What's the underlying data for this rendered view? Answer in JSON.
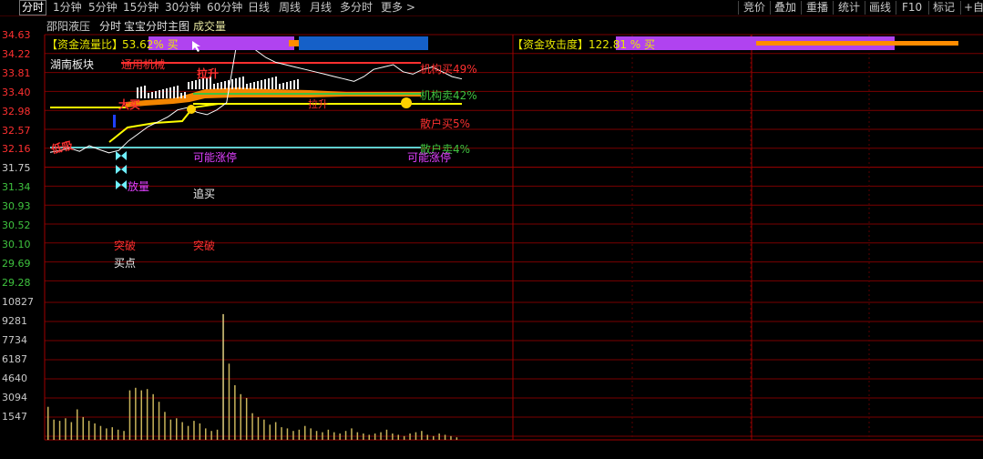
{
  "toolbar": {
    "left": [
      "分时",
      "1分钟",
      "5分钟",
      "15分钟",
      "30分钟",
      "60分钟",
      "日线",
      "周线",
      "月线",
      "多分时",
      "更多 >"
    ],
    "right": [
      "竞价",
      "叠加",
      "重播",
      "统计",
      "画线",
      "F10",
      "标记",
      "+自"
    ]
  },
  "header": {
    "stock_name": "邵阳液压",
    "view": "分时",
    "indicator": "宝宝分时主图",
    "sub_indicator": "成交量"
  },
  "price_axis": [
    "34.63",
    "34.22",
    "33.81",
    "33.40",
    "32.98",
    "32.57",
    "32.16",
    "31.75",
    "31.34",
    "30.93",
    "30.52",
    "30.10",
    "29.69",
    "29.28"
  ],
  "volume_axis": [
    "10827",
    "9281",
    "7734",
    "6187",
    "4640",
    "3094",
    "1547"
  ],
  "fund_flow": {
    "label": "【资金流量比】",
    "value": "53.62% 买"
  },
  "fund_attack": {
    "label": "【资金攻击度】",
    "value": "122.81 % 买"
  },
  "annotations": {
    "sector": "湖南板块",
    "general_machinery": "通用机械",
    "institution_buy": "机构买49%",
    "institution_sell": "机构卖42%",
    "retail_buy": "散户买5%",
    "retail_sell": "散户卖4%",
    "limit_up_left": "可能涨停",
    "limit_up_right": "可能涨停",
    "volume_up": "放量",
    "chase_buy": "追买",
    "breakout_left": "突破",
    "breakout_mid": "突破",
    "buy_point": "买点",
    "pull_up": "拉升",
    "pull_up2": "拉升",
    "big_buy": "大买",
    "dip_buy": "低吸"
  },
  "colors": {
    "price_up": "#ff3030",
    "axis_red": "#ff3030",
    "axis_green": "#3fc33f",
    "grid": "#7a0000",
    "volume_axis": "#c9c9c9",
    "purple": "#b043f0",
    "blue_bar": "#1560c8",
    "orange_bar": "#ff8c00",
    "yellow": "#ffff00",
    "cyan": "#5fd0d0"
  },
  "chart_data": {
    "type": "line",
    "price_range": [
      29.28,
      34.63
    ],
    "volume_range": [
      0,
      10827
    ],
    "price_series": [
      32.16,
      32.2,
      32.25,
      32.18,
      32.3,
      32.22,
      32.15,
      32.2,
      32.4,
      32.55,
      32.7,
      32.8,
      32.9,
      33.05,
      33.1,
      33.0,
      32.95,
      33.05,
      33.2,
      34.4,
      34.5,
      34.3,
      34.15,
      34.05,
      34.0,
      33.95,
      33.9,
      33.85,
      33.8,
      33.75,
      33.7,
      33.65,
      33.75,
      33.9,
      33.95,
      34.0,
      33.85,
      33.8,
      33.9,
      33.95,
      33.85,
      33.75,
      33.7
    ],
    "avg_series": [
      32.16,
      32.25,
      32.32,
      32.4,
      32.5,
      32.6,
      32.72,
      32.82,
      32.9,
      32.98,
      33.05,
      33.15,
      33.25,
      33.3,
      33.33,
      33.36,
      33.38,
      33.4,
      33.4,
      33.4
    ],
    "volumes": [
      2600,
      1600,
      1500,
      1700,
      1400,
      2400,
      1800,
      1500,
      1300,
      1100,
      900,
      1000,
      800,
      700,
      3900,
      4100,
      3900,
      4000,
      3600,
      3000,
      2200,
      1600,
      1700,
      1400,
      1100,
      1500,
      1300,
      900,
      700,
      800,
      9900,
      6000,
      4300,
      3600,
      3300,
      2100,
      1800,
      1600,
      1200,
      1400,
      1000,
      900,
      700,
      800,
      1100,
      900,
      700,
      600,
      800,
      600,
      500,
      700,
      900,
      600,
      500,
      400,
      500,
      600,
      800,
      500,
      400,
      300,
      500,
      600,
      700,
      400,
      300,
      500,
      400,
      300,
      200
    ]
  }
}
